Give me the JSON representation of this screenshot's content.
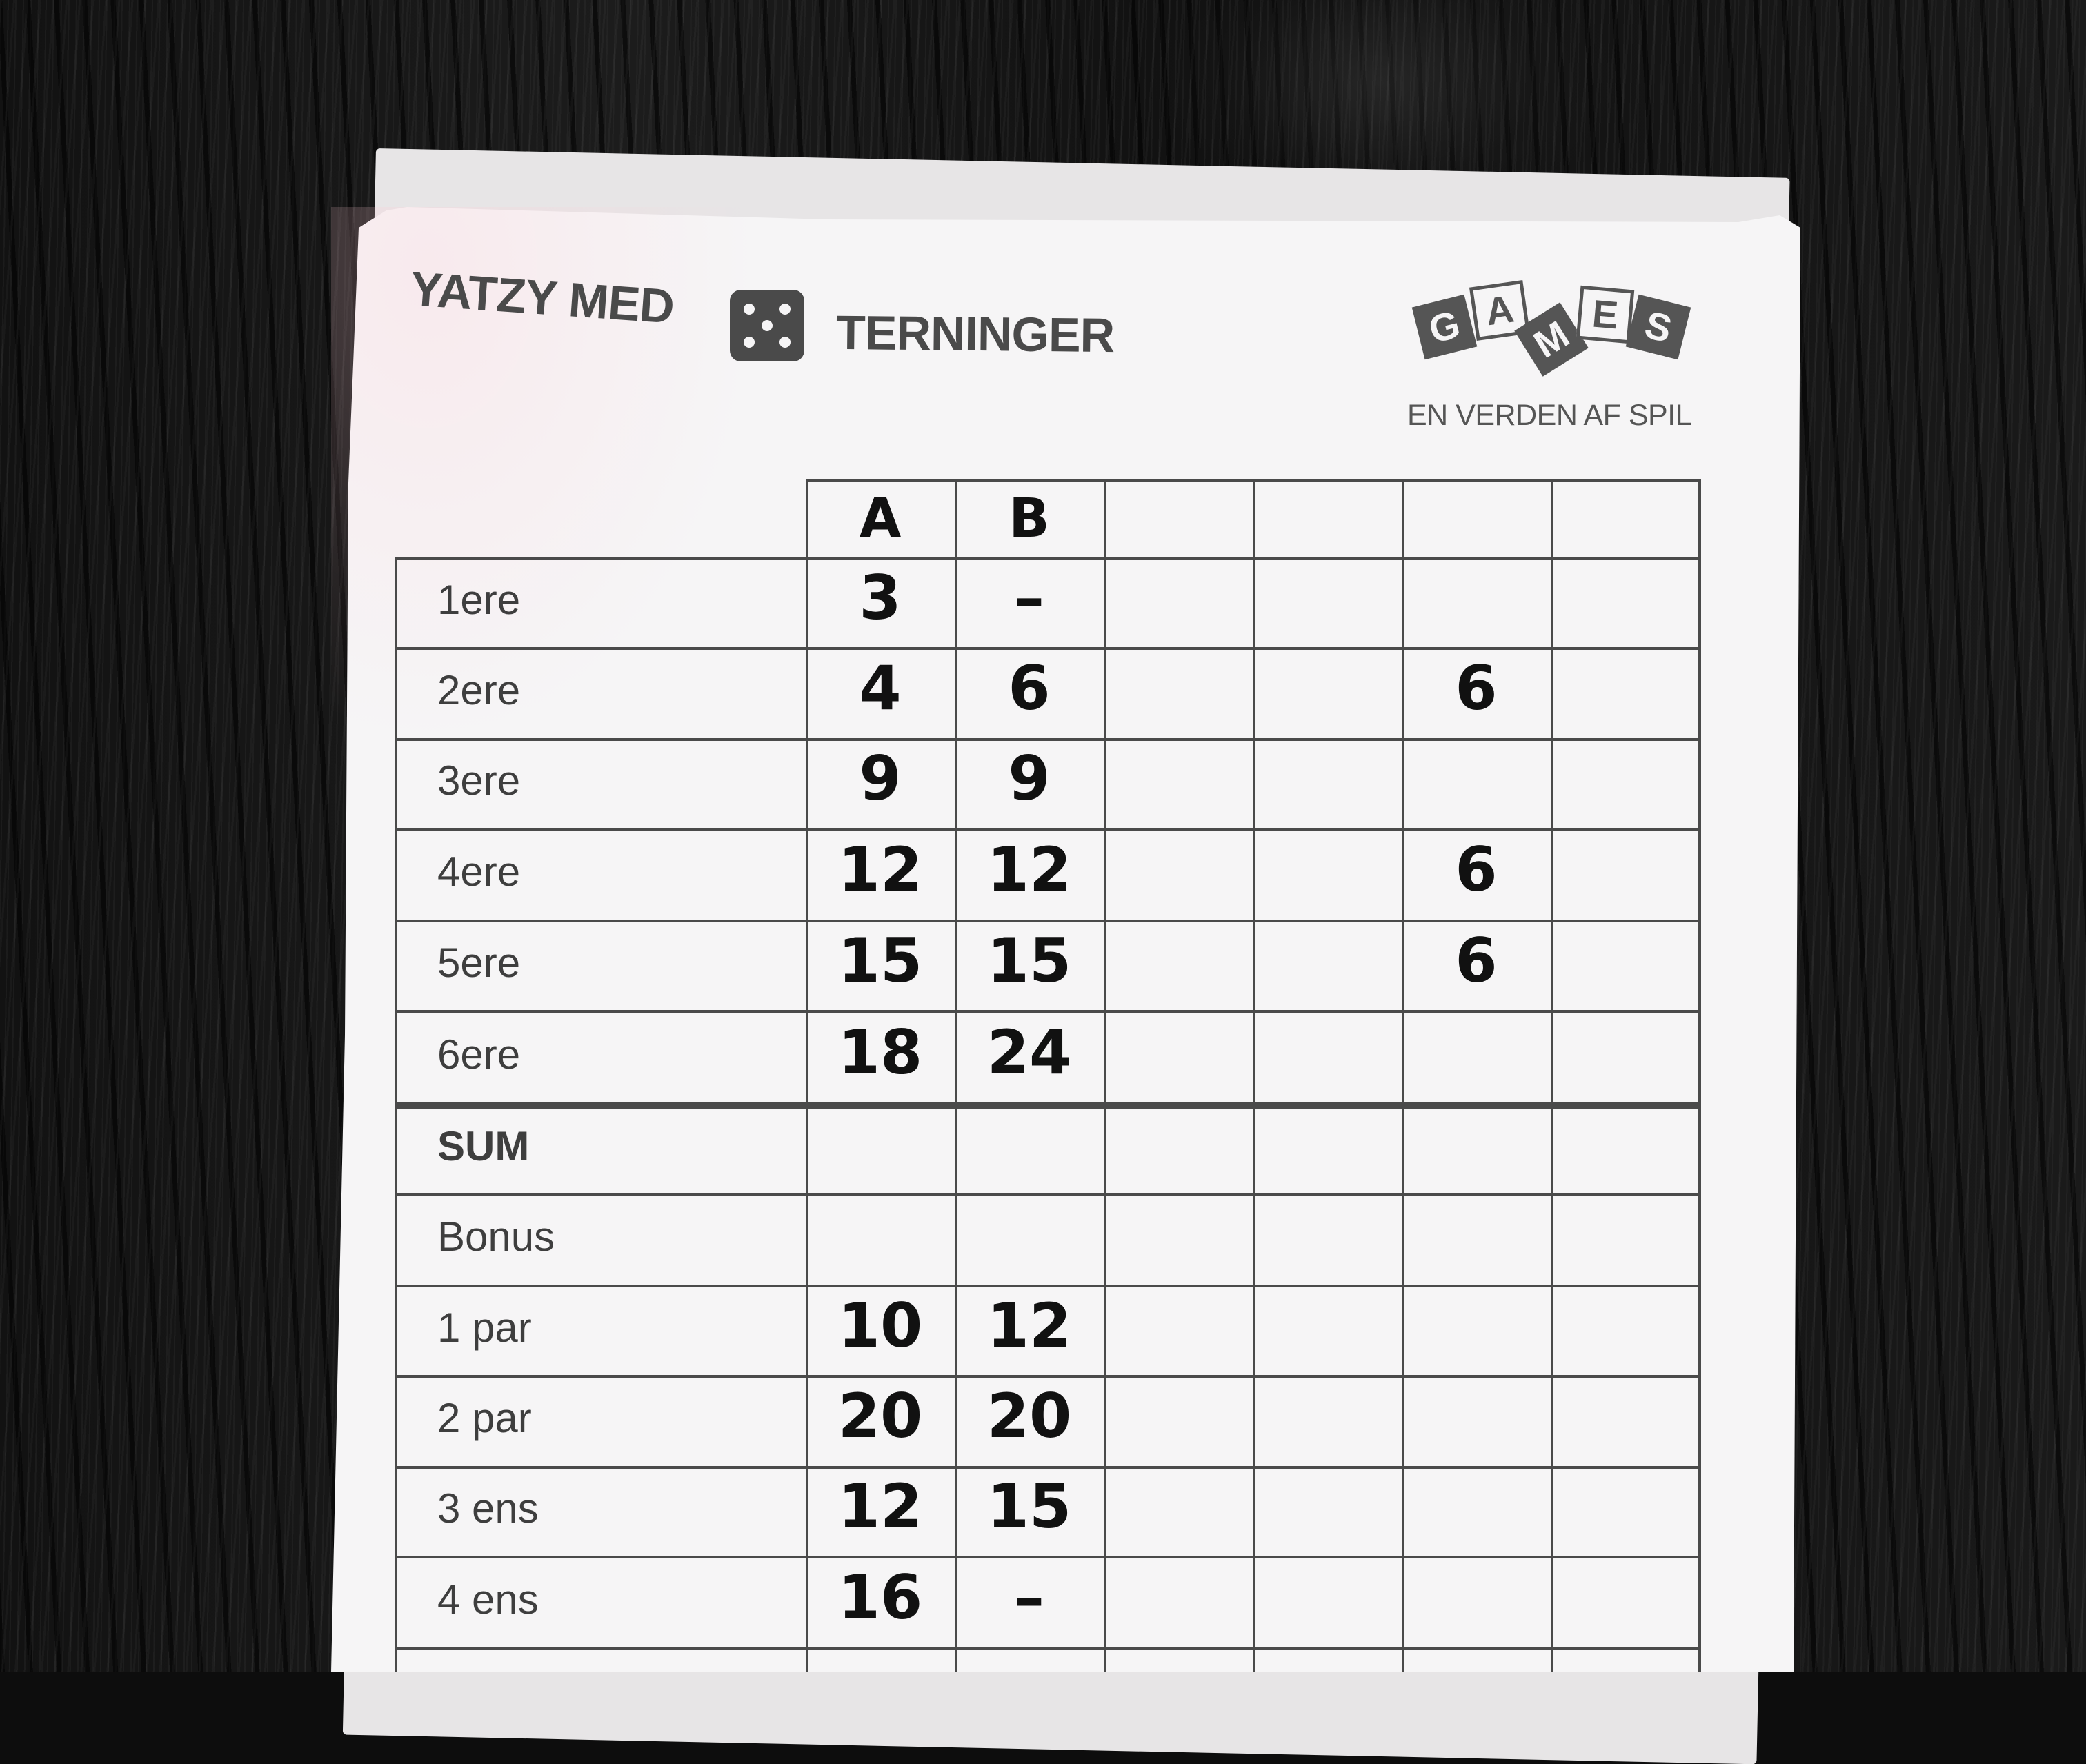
{
  "scoresheet": {
    "title_left": "YATZY MED",
    "title_right": "TERNINGER",
    "logo_letters": [
      "G",
      "A",
      "M",
      "E",
      "S"
    ],
    "slogan": "EN VERDEN AF SPIL",
    "die_icon": "five-pip-die-icon",
    "players": [
      "A",
      "B",
      "",
      "",
      "",
      ""
    ],
    "rows": [
      {
        "label": "1ere",
        "scores": [
          "3",
          "–",
          "",
          "",
          "",
          ""
        ]
      },
      {
        "label": "2ere",
        "scores": [
          "4",
          "6",
          "",
          "",
          "6",
          ""
        ]
      },
      {
        "label": "3ere",
        "scores": [
          "9",
          "9",
          "",
          "",
          "",
          ""
        ]
      },
      {
        "label": "4ere",
        "scores": [
          "12",
          "12",
          "",
          "",
          "6",
          ""
        ]
      },
      {
        "label": "5ere",
        "scores": [
          "15",
          "15",
          "",
          "",
          "6",
          ""
        ]
      },
      {
        "label": "6ere",
        "scores": [
          "18",
          "24",
          "",
          "",
          "",
          ""
        ]
      },
      {
        "label": "SUM",
        "scores": [
          "",
          "",
          "",
          "",
          "",
          ""
        ]
      },
      {
        "label": "Bonus",
        "scores": [
          "",
          "",
          "",
          "",
          "",
          ""
        ]
      },
      {
        "label": "1 par",
        "scores": [
          "10",
          "12",
          "",
          "",
          "",
          ""
        ]
      },
      {
        "label": "2 par",
        "scores": [
          "20",
          "20",
          "",
          "",
          "",
          ""
        ]
      },
      {
        "label": "3 ens",
        "scores": [
          "12",
          "15",
          "",
          "",
          "",
          ""
        ]
      },
      {
        "label": "4 ens",
        "scores": [
          "16",
          "–",
          "",
          "",
          "",
          ""
        ]
      }
    ]
  },
  "colors": {
    "ink": "#111111",
    "print": "#4a4a4a",
    "paper": "#f6f5f6",
    "table": "#0d0d0d"
  }
}
